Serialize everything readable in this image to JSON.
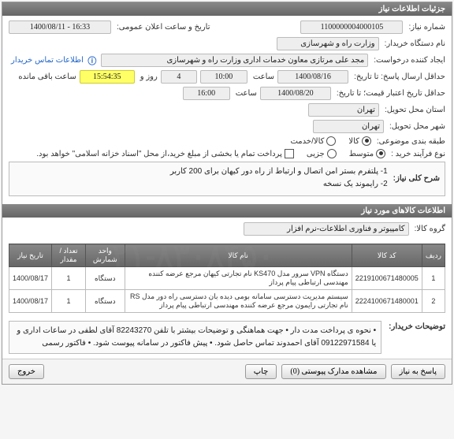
{
  "watermark": "۰۲۱-۸۳۰۸۴۵۰",
  "header": {
    "title": "جزئیات اطلاعات نیاز"
  },
  "fields": {
    "need_no_label": "شماره نیاز:",
    "need_no": "1100000004000105",
    "announce_dt_label": "تاریخ و ساعت اعلان عمومی:",
    "announce_dt": "1400/08/11 - 16:33",
    "buyer_org_label": "نام دستگاه خریدار:",
    "buyer_org": "وزارت راه و شهرسازی",
    "creator_label": "ایجاد کننده درخواست:",
    "creator": "مجد علی  مرتازی معاون خدمات اداری وزارت راه و شهرسازی",
    "info_link": "اطلاعات تماس خریدار",
    "reply_deadline_label": "حداقل ارسال پاسخ: تا تاریخ:",
    "reply_date": "1400/08/16",
    "time_label": "ساعت",
    "reply_time": "10:00",
    "days_count": "4",
    "days_and": "روز و",
    "remaining": "15:54:35",
    "remaining_suffix": "ساعت باقی مانده",
    "validity_label": "حداقل تاریخ اعتبار قیمت؛ تا تاریخ:",
    "validity_date": "1400/08/20",
    "validity_time": "16:00",
    "province_label": "استان محل تحویل:",
    "province": "تهران",
    "city_label": "شهر محل تحویل:",
    "city": "تهران",
    "class_label": "طبقه بندی موضوعی:",
    "class_goods": "کالا",
    "class_service": "کالا/خدمت",
    "buy_type_label": "نوع فرآیند خرید :",
    "buy_type_mid": "متوسط",
    "buy_type_small": "جزیی",
    "pay_note": "پرداخت تمام یا بخشی از مبلغ خرید،از محل \"اسناد خزانه اسلامی\" خواهد بود.",
    "need_summary_label": "شرح کلی نیاز:",
    "need_summary_1": "1- پلتفرم بستر امن اتصال و ارتباط از راه دور کیهان برای 200 کاربر",
    "need_summary_2": "2- رایموند یک نسخه"
  },
  "goods_header": "اطلاعات کالاهای مورد نیاز",
  "group_label": "گروه کالا:",
  "group_value": "کامپیوتر و فناوری اطلاعات-نرم افزار",
  "table": {
    "cols": {
      "row": "ردیف",
      "code": "کد کالا",
      "name": "نام کالا",
      "unit": "واحد شمارش",
      "qty": "تعداد / مقدار",
      "date": "تاریخ نیاز"
    },
    "rows": [
      {
        "row": "1",
        "code": "2219100671480005",
        "name": "دستگاه VPN سرور مدل KS470 نام تجارتی کیهان مرجع عرضه کننده مهندسی ارتباطی پیام پرداز",
        "unit": "دستگاه",
        "qty": "1",
        "date": "1400/08/17"
      },
      {
        "row": "2",
        "code": "2224100671480001",
        "name": "سیستم مدیریت دسترسی سامانه بومی دیده بان دسترسی راه دور مدل RS نام تجارتی رایمون مرجع عرضه کننده مهندسی ارتباطی پیام پرداز",
        "unit": "دستگاه",
        "qty": "1",
        "date": "1400/08/17"
      }
    ]
  },
  "buyer_note_label": "توضیحات خریدار:",
  "buyer_note_text": "• نحوه ی پرداخت مدت دار  • جهت هماهنگی و توضیحات بیشتر با تلفن 82243270 آقای لطفی در ساعات اداری و یا 09122971584 آقای احمدوند تماس حاصل شود. • پیش فاکتور در سامانه پیوست شود. • فاکتور رسمی",
  "footer": {
    "reply": "پاسخ به نیاز",
    "attach": "مشاهده مدارک پیوستی (0)",
    "print": "چاپ",
    "close": "خروج"
  }
}
